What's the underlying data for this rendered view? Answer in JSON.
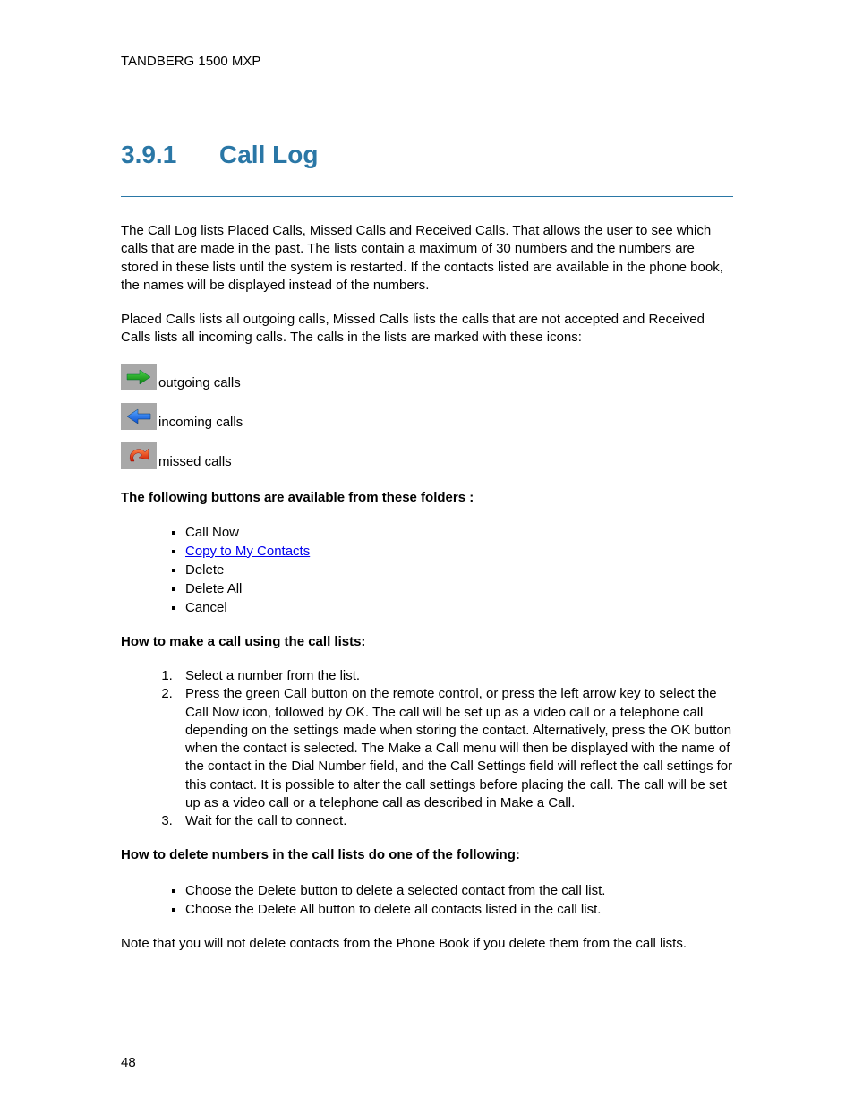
{
  "header": "TANDBERG 1500 MXP",
  "section": {
    "number": "3.9.1",
    "title": "Call Log"
  },
  "para1": "The Call Log lists Placed Calls, Missed Calls and Received Calls. That allows the user to see which calls that are made in the past. The lists contain a maximum of 30 numbers and the numbers are stored in these lists until the system is restarted. If the contacts listed are available in the phone book, the names will be displayed instead of the numbers.",
  "para2": "Placed Calls lists all outgoing calls, Missed Calls lists the calls that are not accepted and Received Calls lists all incoming calls. The calls in the lists are marked with these icons:",
  "icons": {
    "outgoing": "outgoing calls",
    "incoming": "incoming calls",
    "missed": "missed calls"
  },
  "buttons_heading": "The following buttons are available from these folders :",
  "buttons_list": [
    "Call Now",
    "Copy to My Contacts",
    "Delete",
    "Delete All",
    "Cancel"
  ],
  "howto_call_heading": "How to make a call using the call lists:",
  "howto_call_steps": [
    "Select a number from the list.",
    "Press the green Call button on the remote control, or press the left arrow key to select the Call Now icon, followed by OK. The call will be set up as a video call or a telephone call depending on the settings made when storing the contact. Alternatively, press the OK button when the contact is selected. The Make a Call menu will then be displayed with the name of the contact in the Dial Number field, and the Call Settings field will reflect the call settings for this contact. It is possible to alter the call settings before placing the call. The call will be set up as a video call or a telephone call as described in Make a Call.",
    "Wait for the call to connect."
  ],
  "howto_delete_heading": "How to delete numbers in the call lists do one of the following:",
  "howto_delete_list": [
    "Choose the Delete button to delete a selected contact from the call list.",
    "Choose the Delete All button to delete all contacts listed in the call list."
  ],
  "note": "Note that you will not delete contacts from the Phone Book if you delete them from the call lists.",
  "page_number": "48"
}
